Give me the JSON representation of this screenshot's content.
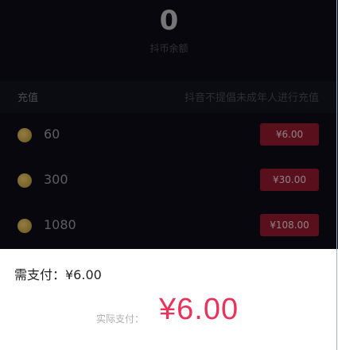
{
  "balance": {
    "value": "0",
    "label": "抖币余额"
  },
  "recharge": {
    "title": "充值",
    "note": "抖音不提倡未成年人进行充值",
    "options": [
      {
        "coins": "60",
        "price": "¥6.00"
      },
      {
        "coins": "300",
        "price": "¥30.00"
      },
      {
        "coins": "1080",
        "price": "¥108.00"
      }
    ]
  },
  "payment": {
    "need_pay": "需支付：¥6.00",
    "actual_label": "实际支付：",
    "actual_amount": "¥6.00"
  },
  "colors": {
    "background_dark": "#0c0c14",
    "price_button": "#8a1a2c",
    "accent_red": "#e8335a",
    "coin": "#c9a445"
  },
  "icons": [
    "coin-icon"
  ]
}
